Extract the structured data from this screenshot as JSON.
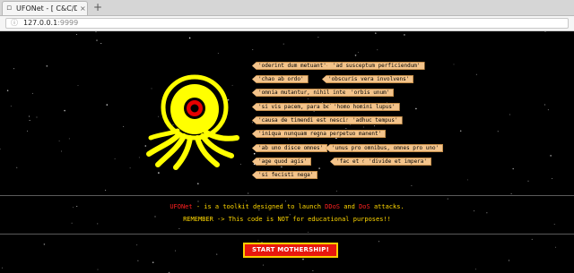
{
  "browser": {
    "tab_title": "UFONet - [ C&C/Da",
    "tab_close": "×",
    "new_tab": "+",
    "url_host": "127.0.0.1",
    "url_port": ":9999",
    "info_icon": "info-circle-icon",
    "favicon": "page-icon"
  },
  "mottos": [
    "'oderint dum metuant'",
    "'ad susceptum perficiendum'",
    "'chao ab ordo'",
    "'obscuris vera involvens'",
    "'omnia mutantur, nihil interit'",
    "'orbis unum'",
    "'si vis pacem, para bellum'",
    "'homo homini lupus'",
    "'causa de timendi est nescire'",
    "'adhuc tempus'",
    "'iniqua nunquam regna perpetuo manent'",
    "'ab uno disce omnes'",
    "'unus pro omnibus, omnes pro uno'",
    "'age quod agis'",
    "'fac et excusa'",
    "'divide et impera'",
    "'si fecisti nega'"
  ],
  "description": {
    "brand": "UFONet",
    "part1": " - is a toolkit designed to launch ",
    "ddos": "DDoS",
    "part2": " and ",
    "dos": "DoS",
    "part3": " attacks.",
    "remember": "REMEMBER -> This code is NOT for educational purposes!!"
  },
  "start_button": "START MOTHERSHIP!",
  "colors": {
    "background": "#000000",
    "logo": "#ffff00",
    "eye": "#e60000",
    "motto_tag": "#f3c38a",
    "text": "#ffd700",
    "highlight": "#ff2020",
    "button": "#e8170e",
    "button_border": "#ffcc00"
  }
}
